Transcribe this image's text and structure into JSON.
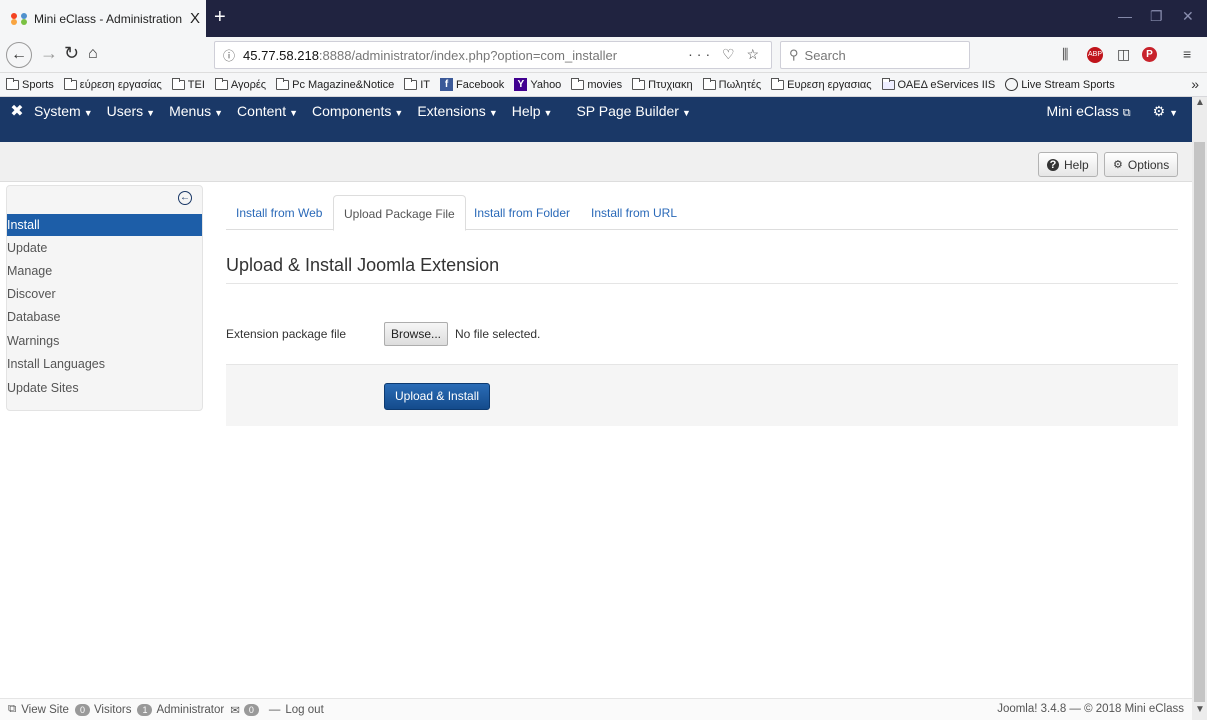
{
  "browser": {
    "tab_title": "Mini eClass - Administration - |",
    "tab_close": "X",
    "new_tab": "+",
    "url_host": "45.77.58.218",
    "url_rest": ":8888/administrator/index.php?option=com_installer",
    "url_actions": "··· ♡ ☆",
    "search_placeholder": "Search",
    "bookmarks": [
      {
        "label": "Sports",
        "icon": "folder-icon"
      },
      {
        "label": "εύρεση εργασίας",
        "icon": "folder-icon"
      },
      {
        "label": "TEI",
        "icon": "folder-icon"
      },
      {
        "label": "Αγορές",
        "icon": "folder-icon"
      },
      {
        "label": "Pc Magazine&Notice",
        "icon": "folder-icon"
      },
      {
        "label": "IT",
        "icon": "folder-icon"
      },
      {
        "label": "Facebook",
        "icon": "facebook-icon"
      },
      {
        "label": "Yahoo",
        "icon": "yahoo-icon"
      },
      {
        "label": "movies",
        "icon": "folder-icon"
      },
      {
        "label": "Πτυχιακη",
        "icon": "folder-icon"
      },
      {
        "label": "Πωλητές",
        "icon": "folder-icon"
      },
      {
        "label": "Ευρεση εργασιας",
        "icon": "folder-icon"
      },
      {
        "label": "ΟΑΕΔ eServices IIS",
        "icon": "page-icon"
      },
      {
        "label": "Live Stream Sports",
        "icon": "globe-icon"
      }
    ]
  },
  "adminbar": {
    "menu": [
      {
        "label": "System"
      },
      {
        "label": "Users"
      },
      {
        "label": "Menus"
      },
      {
        "label": "Content"
      },
      {
        "label": "Components"
      },
      {
        "label": "Extensions"
      },
      {
        "label": "Help"
      },
      {
        "label": "SP Page Builder"
      }
    ],
    "site_link": "Mini eClass"
  },
  "toolbar": {
    "help_label": "Help",
    "options_label": "Options"
  },
  "sidebar": {
    "items": [
      {
        "label": "Install"
      },
      {
        "label": "Update"
      },
      {
        "label": "Manage"
      },
      {
        "label": "Discover"
      },
      {
        "label": "Database"
      },
      {
        "label": "Warnings"
      },
      {
        "label": "Install Languages"
      },
      {
        "label": "Update Sites"
      }
    ]
  },
  "main": {
    "tabs": [
      {
        "label": "Install from Web"
      },
      {
        "label": "Upload Package File"
      },
      {
        "label": "Install from Folder"
      },
      {
        "label": "Install from URL"
      }
    ],
    "heading": "Upload & Install Joomla Extension",
    "field_label": "Extension package file",
    "browse_label": "Browse...",
    "file_status": "No file selected.",
    "submit_label": "Upload & Install"
  },
  "status": {
    "view_site": "View Site",
    "visitors_count": "0",
    "visitors_label": "Visitors",
    "admins_count": "1",
    "admins_label": "Administrator",
    "messages_count": "0",
    "logout_label": "Log out",
    "copyright": "Joomla! 3.4.8 — © 2018 Mini eClass"
  }
}
